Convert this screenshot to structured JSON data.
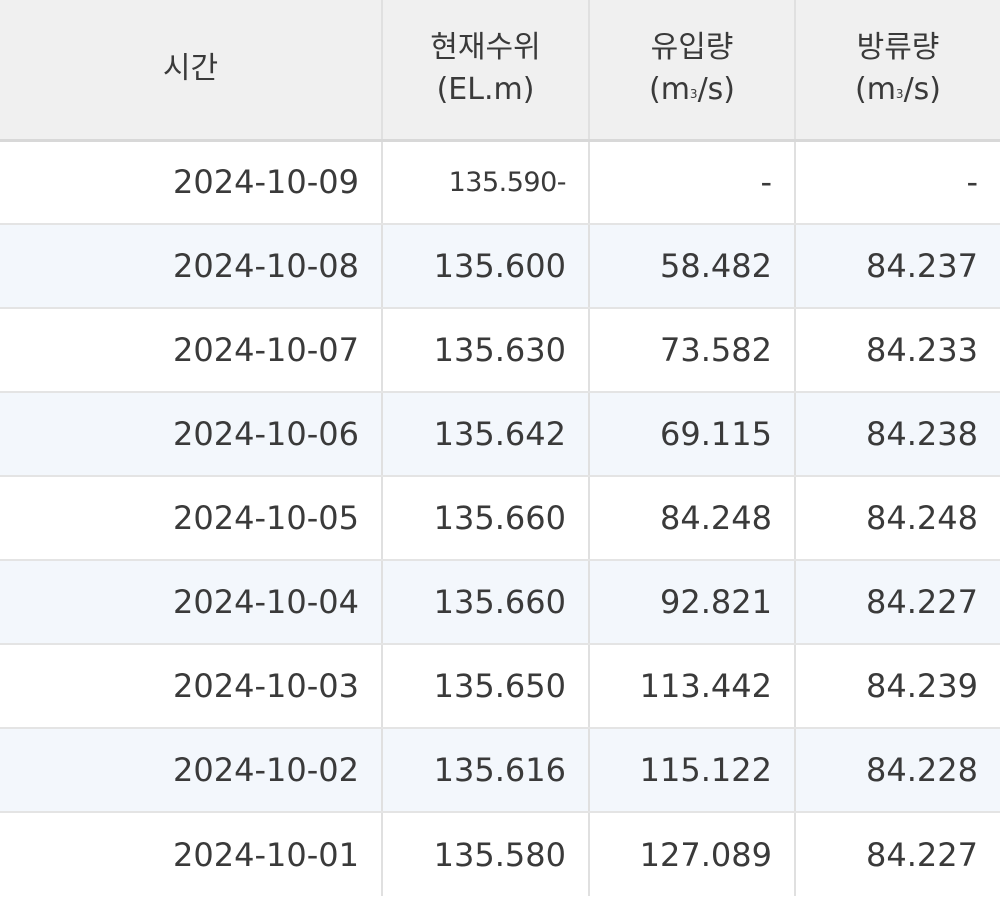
{
  "table": {
    "headers": {
      "time": "시간",
      "level": {
        "line1": "현재수위",
        "line2": "(EL.m)"
      },
      "inflow": {
        "line1": "유입량",
        "line2_pre": "(m",
        "line2_sup": "3",
        "line2_post": "/s)"
      },
      "outflow": {
        "line1": "방류량",
        "line2_pre": "(m",
        "line2_sup": "3",
        "line2_post": "/s)"
      }
    },
    "rows": [
      {
        "time": "2024-10-09",
        "level": "135.590-",
        "inflow": "-",
        "outflow": "-"
      },
      {
        "time": "2024-10-08",
        "level": "135.600",
        "inflow": "58.482",
        "outflow": "84.237"
      },
      {
        "time": "2024-10-07",
        "level": "135.630",
        "inflow": "73.582",
        "outflow": "84.233"
      },
      {
        "time": "2024-10-06",
        "level": "135.642",
        "inflow": "69.115",
        "outflow": "84.238"
      },
      {
        "time": "2024-10-05",
        "level": "135.660",
        "inflow": "84.248",
        "outflow": "84.248"
      },
      {
        "time": "2024-10-04",
        "level": "135.660",
        "inflow": "92.821",
        "outflow": "84.227"
      },
      {
        "time": "2024-10-03",
        "level": "135.650",
        "inflow": "113.442",
        "outflow": "84.239"
      },
      {
        "time": "2024-10-02",
        "level": "135.616",
        "inflow": "115.122",
        "outflow": "84.228"
      },
      {
        "time": "2024-10-01",
        "level": "135.580",
        "inflow": "127.089",
        "outflow": "84.227"
      }
    ]
  }
}
